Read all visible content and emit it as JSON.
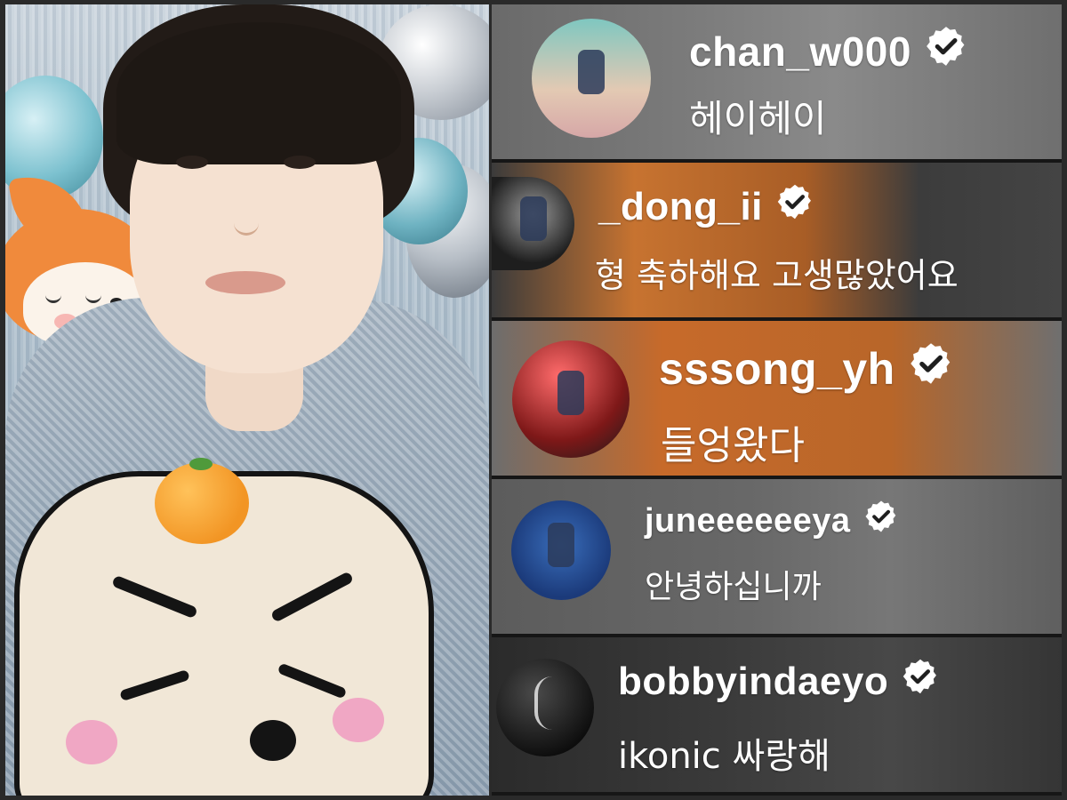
{
  "photo": {
    "alt": "selfie with cake"
  },
  "comments": [
    {
      "username": "chan_w000",
      "message": "헤이헤이",
      "verified": true,
      "avatar_icon": "avatar-chan"
    },
    {
      "username": "_dong_ii",
      "message": "형 축하해요 고생많았어요",
      "verified": true,
      "avatar_icon": "avatar-dong"
    },
    {
      "username": "sssong_yh",
      "message": "들엉왔다",
      "verified": true,
      "avatar_icon": "avatar-sssong"
    },
    {
      "username": "juneeeeeeya",
      "message": "안녕하십니까",
      "verified": true,
      "avatar_icon": "avatar-june"
    },
    {
      "username": "bobbyindaeyo",
      "message": "ikonic 싸랑해",
      "verified": true,
      "avatar_icon": "avatar-bobby"
    }
  ],
  "colors": {
    "frame": "#2a2a2a",
    "text": "#ffffff"
  }
}
